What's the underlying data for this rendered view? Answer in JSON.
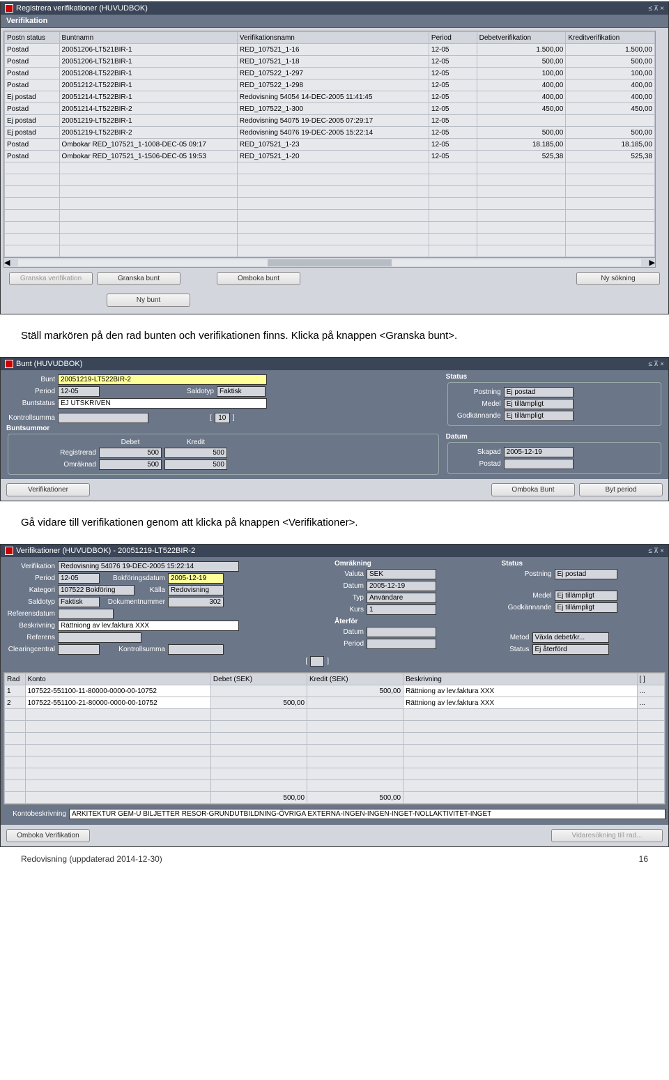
{
  "win1": {
    "title": "Registrera verifikationer (HUVUDBOK)",
    "panel": "Verifikation",
    "headers": [
      "Postn status",
      "Buntnamn",
      "Verifikationsnamn",
      "Period",
      "Debetverifikation",
      "Kreditverifikation"
    ],
    "rows": [
      {
        "s": "Postad",
        "b": "20051206-LT521BIR-1",
        "v": "RED_107521_1-16",
        "p": "12-05",
        "d": "1.500,00",
        "k": "1.500,00"
      },
      {
        "s": "Postad",
        "b": "20051206-LT521BIR-1",
        "v": "RED_107521_1-18",
        "p": "12-05",
        "d": "500,00",
        "k": "500,00"
      },
      {
        "s": "Postad",
        "b": "20051208-LT522BIR-1",
        "v": "RED_107522_1-297",
        "p": "12-05",
        "d": "100,00",
        "k": "100,00"
      },
      {
        "s": "Postad",
        "b": "20051212-LT522BIR-1",
        "v": "RED_107522_1-298",
        "p": "12-05",
        "d": "400,00",
        "k": "400,00"
      },
      {
        "s": "Ej postad",
        "b": "20051214-LT522BIR-1",
        "v": "Redovisning 54054 14-DEC-2005 11:41:45",
        "p": "12-05",
        "d": "400,00",
        "k": "400,00"
      },
      {
        "s": "Postad",
        "b": "20051214-LT522BIR-2",
        "v": "RED_107522_1-300",
        "p": "12-05",
        "d": "450,00",
        "k": "450,00"
      },
      {
        "s": "Ej postad",
        "b": "20051219-LT522BIR-1",
        "v": "Redovisning 54075 19-DEC-2005 07:29:17",
        "p": "12-05",
        "d": "",
        "k": ""
      },
      {
        "s": "Ej postad",
        "b": "20051219-LT522BIR-2",
        "v": "Redovisning 54076 19-DEC-2005 15:22:14",
        "p": "12-05",
        "d": "500,00",
        "k": "500,00",
        "sel": true
      },
      {
        "s": "Postad",
        "b": "Ombokar RED_107521_1-1008-DEC-05 09:17",
        "v": "RED_107521_1-23",
        "p": "12-05",
        "d": "18.185,00",
        "k": "18.185,00"
      },
      {
        "s": "Postad",
        "b": "Ombokar RED_107521_1-1506-DEC-05 19:53",
        "v": "RED_107521_1-20",
        "p": "12-05",
        "d": "525,38",
        "k": "525,38"
      }
    ],
    "btns": {
      "granska_ver": "Granska verifikation",
      "granska_bunt": "Granska bunt",
      "omboka": "Omboka bunt",
      "ny_sok": "Ny sökning",
      "ny_bunt": "Ny bunt"
    }
  },
  "text1": "Ställ markören på den rad bunten och verifikationen finns. Klicka på knappen <Granska bunt>.",
  "win2": {
    "title": "Bunt (HUVUDBOK)",
    "labels": {
      "bunt": "Bunt",
      "period": "Period",
      "status": "Buntstatus",
      "saldotyp": "Saldotyp",
      "kontroll": "Kontrollsumma",
      "buntsummor": "Buntsummor",
      "debet": "Debet",
      "kredit": "Kredit",
      "reg": "Registrerad",
      "omr": "Omräknad",
      "statusTitle": "Status",
      "postning": "Postning",
      "medel": "Medel",
      "godk": "Godkännande",
      "datum": "Datum",
      "skapad": "Skapad",
      "postad": "Postad"
    },
    "vals": {
      "bunt": "20051219-LT522BIR-2",
      "period": "12-05",
      "saldotyp": "Faktisk",
      "status": "EJ UTSKRIVEN",
      "kontroll": "",
      "ten": "10",
      "reg_d": "500",
      "reg_k": "500",
      "omr_d": "500",
      "omr_k": "500",
      "postning": "Ej postad",
      "medel": "Ej tillämpligt",
      "godk": "Ej tillämpligt",
      "skapad": "2005-12-19",
      "postad": ""
    },
    "btns": {
      "ver": "Verifikationer",
      "omboka": "Omboka Bunt",
      "byt": "Byt period"
    }
  },
  "text2": "Gå vidare till verifikationen genom att klicka på knappen <Verifikationer>.",
  "win3": {
    "title": "Verifikationer (HUVUDBOK) - 20051219-LT522BIR-2",
    "labels": {
      "verifikation": "Verifikation",
      "period": "Period",
      "kategori": "Kategori",
      "saldotyp": "Saldotyp",
      "refdatum": "Referensdatum",
      "beskr": "Beskrivning",
      "referens": "Referens",
      "clearing": "Clearingcentral",
      "bokfdatum": "Bokföringsdatum",
      "kalla": "Källa",
      "doknr": "Dokumentnummer",
      "kontroll": "Kontrollsumma",
      "omrakning": "Omräkning",
      "valuta": "Valuta",
      "datum": "Datum",
      "typ": "Typ",
      "kurs": "Kurs",
      "aterfor": "Återför",
      "met": "Metod",
      "aterstatus": "Status",
      "status": "Status",
      "postning": "Postning",
      "medel": "Medel",
      "godk": "Godkännande",
      "rad": "Rad",
      "konto": "Konto",
      "debet_sek": "Debet (SEK)",
      "kredit_sek": "Kredit (SEK)",
      "beskrivning": "Beskrivning",
      "kontobeskr": "Kontobeskrivning"
    },
    "vals": {
      "verifikation": "Redovisning 54076 19-DEC-2005 15:22:14",
      "period": "12-05",
      "kategori": "107522 Bokföring",
      "saldotyp": "Faktisk",
      "refdatum": "",
      "beskr": "Rättniong av lev.faktura XXX",
      "referens": "",
      "clearing": "",
      "bokfdatum": "2005-12-19",
      "kalla": "Redovisning",
      "doknr": "302",
      "kontroll": "",
      "valuta": "SEK",
      "datum": "2005-12-19",
      "typ": "Användare",
      "kurs": "1",
      "aterdatum": "",
      "aterperiod": "",
      "metod": "Växla debet/kr...",
      "aterstatus": "Ej återförd",
      "postning": "Ej postad",
      "medel": "Ej tillämpligt",
      "godk": "Ej tillämpligt",
      "kontobeskr": "ARKITEKTUR GEM-U BILJETTER RESOR-GRUNDUTBILDNING-ÖVRIGA EXTERNA-INGEN-INGEN-INGET-NOLLAKTIVITET-INGET"
    },
    "lines": [
      {
        "rad": "1",
        "konto": "107522-551100-11-80000-0000-00-10752",
        "debet": "",
        "kredit": "500,00",
        "beskr": "Rättniong av lev.faktura XXX"
      },
      {
        "rad": "2",
        "konto": "107522-551100-21-80000-0000-00-10752",
        "debet": "500,00",
        "kredit": "",
        "beskr": "Rättniong av lev.faktura XXX"
      }
    ],
    "totals": {
      "debet": "500,00",
      "kredit": "500,00"
    },
    "btns": {
      "omboka": "Omboka Verifikation",
      "vidare": "Vidaresökning till rad..."
    }
  },
  "footer": {
    "left": "Redovisning (uppdaterad 2014-12-30)",
    "page": "16"
  }
}
